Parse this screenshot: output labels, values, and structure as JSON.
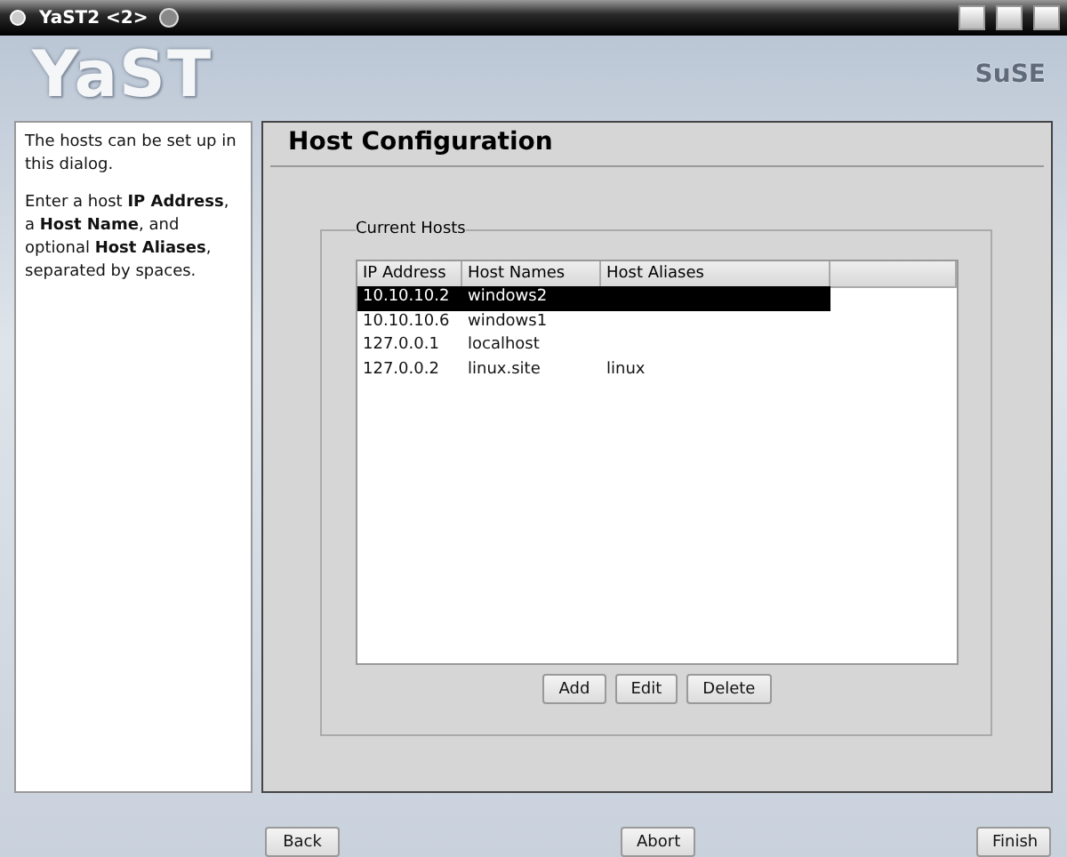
{
  "window": {
    "title": "YaST2 <2>"
  },
  "header": {
    "logo": "YaST",
    "brand": "SuSE"
  },
  "help": [
    "The hosts can be set up in this dialog.",
    "Enter a host **IP Address**, a **Host Name**, and optional **Host Aliases**, separated by spaces."
  ],
  "dialog": {
    "title": "Host Configuration",
    "group": "Current Hosts",
    "table": {
      "columns": [
        "IP Address",
        "Host Names",
        "Host Aliases"
      ],
      "rows": [
        {
          "cells": [
            "10.10.10.2",
            "windows2",
            ""
          ],
          "selected": true
        },
        {
          "cells": [
            "10.10.10.6",
            "windows1",
            ""
          ],
          "selected": false
        },
        {
          "cells": [
            "127.0.0.1",
            "localhost",
            ""
          ],
          "selected": false
        },
        {
          "cells": [
            "127.0.0.2",
            "linux.site",
            "linux"
          ],
          "selected": false
        }
      ]
    },
    "buttons": [
      "Add",
      "Edit",
      "Delete"
    ]
  },
  "footer": {
    "buttons": [
      "Back",
      "Abort",
      "Finish"
    ]
  }
}
